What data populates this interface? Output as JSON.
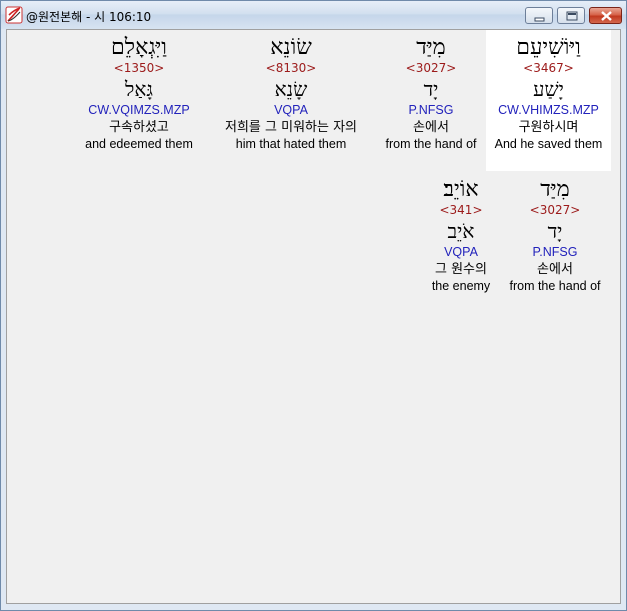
{
  "window": {
    "title": "@원전본해 - 시 106:10"
  },
  "icons": {
    "app": "app-feather-icon",
    "minimize": "minimize-icon",
    "maximize": "maximize-icon",
    "close": "close-icon"
  },
  "colors": {
    "strong_number": "#9c1a1a",
    "parsing": "#2222bb",
    "selected_bg": "#ffffff",
    "panel_bg": "#f0f0f0"
  },
  "words": [
    {
      "hebrew": "וַיּוֹשִׁיעֵם",
      "strong": "<3467>",
      "lemma": "יָשַׁע",
      "parsing": "CW.VHIMZS.MZP",
      "korean": "구원하시며",
      "english": "And he saved them",
      "selected": true
    },
    {
      "hebrew": "מִיַּד",
      "strong": "<3027>",
      "lemma": "יָד",
      "parsing": "P.NFSG",
      "korean": "손에서",
      "english": "from the hand of",
      "selected": false
    },
    {
      "hebrew": "שׂוֹנֵא",
      "strong": "<8130>",
      "lemma": "שָׂנֵא",
      "parsing": "VQPA",
      "korean": "저희를 그 미워하는 자의",
      "english": "him that hated them",
      "selected": false
    },
    {
      "hebrew": "וַיִּגְאָלֵם",
      "strong": "<1350>",
      "lemma": "גָּאַל",
      "parsing": "CW.VQIMZS.MZP",
      "korean": "구속하셨고",
      "english": "and edeemed them",
      "selected": false
    },
    {
      "hebrew": "מִיַּד",
      "strong": "<3027>",
      "lemma": "יָד",
      "parsing": "P.NFSG",
      "korean": "손에서",
      "english": "from the hand of",
      "selected": false
    },
    {
      "hebrew": "אוֹיֵב׃",
      "strong": "<341>",
      "lemma": "אֹיֵב",
      "parsing": "VQPA",
      "korean": "그 원수의",
      "english": "the enemy",
      "selected": false
    }
  ]
}
